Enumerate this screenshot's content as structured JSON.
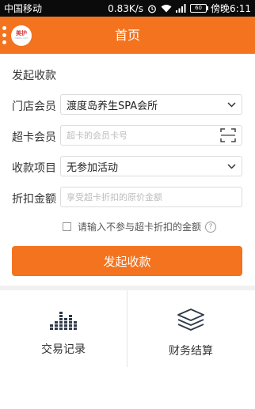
{
  "status_bar": {
    "carrier": "中国移动",
    "speed": "0.83K/s",
    "battery": "60",
    "time": "傍晚6:11"
  },
  "header": {
    "title": "首页",
    "logo_line1": "美护",
    "logo_line2": "meihu.com",
    "brand_color": "#f3731f"
  },
  "form": {
    "section_title": "发起收款",
    "store_member": {
      "label": "门店会员",
      "value": "渡度岛养生SPA会所"
    },
    "card_member": {
      "label": "超卡会员",
      "placeholder": "超卡的会员卡号"
    },
    "payment_item": {
      "label": "收款项目",
      "value": "无参加活动"
    },
    "discount_amount": {
      "label": "折扣金额",
      "placeholder": "享受超卡折扣的原价金额"
    },
    "exclude_checkbox": {
      "label": "请输入不参与超卡折扣的金额",
      "checked": false
    },
    "submit_label": "发起收款"
  },
  "tiles": [
    {
      "label": "交易记录",
      "icon": "bar-chart-icon"
    },
    {
      "label": "财务结算",
      "icon": "layers-icon"
    }
  ]
}
